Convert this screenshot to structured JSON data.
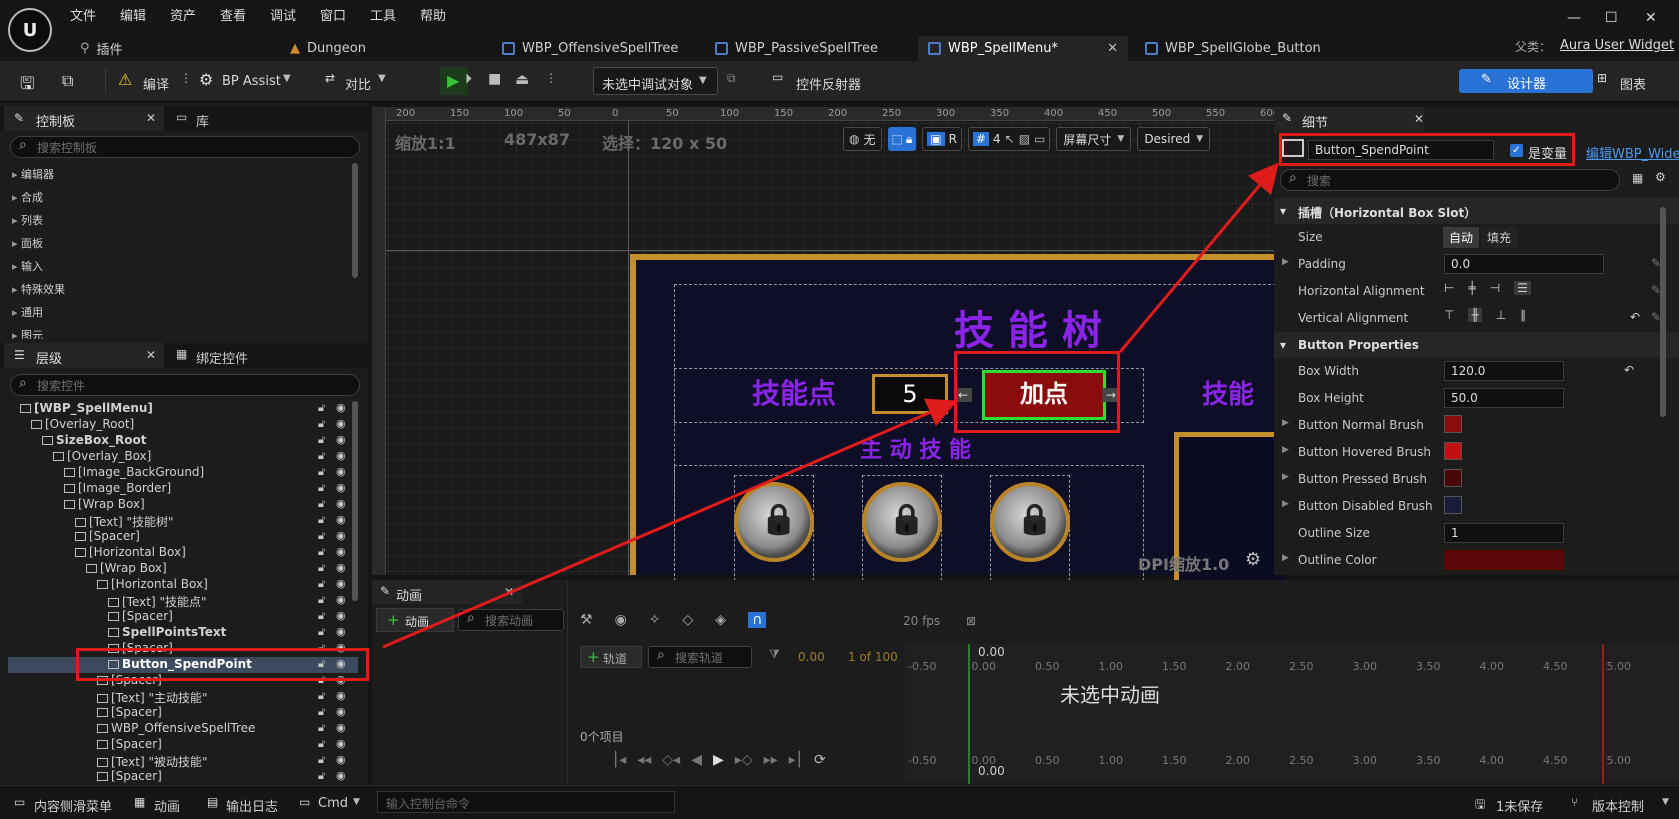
{
  "app": {
    "menu": [
      "文件",
      "编辑",
      "资产",
      "查看",
      "调试",
      "窗口",
      "工具",
      "帮助"
    ],
    "tabs": [
      "插件",
      "Dungeon",
      "WBP_OffensiveSpellTree",
      "WBP_PassiveSpellTree",
      "WBP_SpellMenu*",
      "WBP_SpellGlobe_Button"
    ],
    "parent_label": "父类：",
    "parent_value": "Aura User Widget"
  },
  "toolbar": {
    "compile": "编译",
    "bp_assist": "BP Assist",
    "diff": "对比",
    "debug_target": "未选中调试对象",
    "widget_reflector": "控件反射器",
    "designer": "设计器",
    "graph": "图表"
  },
  "palette": {
    "tab": "控制板",
    "lib_tab": "库",
    "search_placeholder": "搜索控制板",
    "items": [
      "编辑器",
      "合成",
      "列表",
      "面板",
      "输入",
      "特殊效果",
      "通用",
      "图元"
    ]
  },
  "hierarchy": {
    "tab": "层级",
    "bind_tab": "绑定控件",
    "search_placeholder": "搜索控件",
    "rows": [
      {
        "label": "[WBP_SpellMenu]",
        "indent": 0,
        "bold": true
      },
      {
        "label": "[Overlay_Root]",
        "indent": 1
      },
      {
        "label": "SizeBox_Root",
        "indent": 2,
        "bold": true
      },
      {
        "label": "[Overlay_Box]",
        "indent": 3
      },
      {
        "label": "[Image_BackGround]",
        "indent": 4
      },
      {
        "label": "[Image_Border]",
        "indent": 4
      },
      {
        "label": "[Wrap Box]",
        "indent": 4
      },
      {
        "label": "[Text] \"技能树\"",
        "indent": 5
      },
      {
        "label": "[Spacer]",
        "indent": 5
      },
      {
        "label": "[Horizontal Box]",
        "indent": 5
      },
      {
        "label": "[Wrap Box]",
        "indent": 6
      },
      {
        "label": "[Horizontal Box]",
        "indent": 7
      },
      {
        "label": "[Text] \"技能点\"",
        "indent": 8
      },
      {
        "label": "[Spacer]",
        "indent": 8
      },
      {
        "label": "SpellPointsText",
        "indent": 8,
        "bold": true
      },
      {
        "label": "[Spacer]",
        "indent": 8
      },
      {
        "label": "Button_SpendPoint",
        "indent": 8,
        "bold": true,
        "selected": true
      },
      {
        "label": "[Spacer]",
        "indent": 7
      },
      {
        "label": "[Text] \"主动技能\"",
        "indent": 7
      },
      {
        "label": "[Spacer]",
        "indent": 7
      },
      {
        "label": "WBP_OffensiveSpellTree",
        "indent": 7
      },
      {
        "label": "[Spacer]",
        "indent": 7
      },
      {
        "label": "[Text] \"被动技能\"",
        "indent": 7
      },
      {
        "label": "[Spacer]",
        "indent": 7
      }
    ]
  },
  "canvas": {
    "zoom": "缩放1:1",
    "size": "487x87",
    "selection": "选择：120 x 50",
    "none_label": "无",
    "r_label": "R",
    "grid_num": "4",
    "screen_size": "屏幕尺寸",
    "desired": "Desired",
    "dpi": "DPI缩放1.0",
    "ruler": [
      "200",
      "150",
      "100",
      "50",
      "0",
      "50",
      "100",
      "150",
      "200",
      "250",
      "300",
      "350",
      "400",
      "450",
      "500",
      "550",
      "600"
    ],
    "title": "技 能 树",
    "points_label": "技能点",
    "points_value": "5",
    "button_text": "加点",
    "offensive_label": "主 动 技 能",
    "right_partial": "技能"
  },
  "details": {
    "tab": "细节",
    "name": "Button_SpendPoint",
    "is_variable": "是变量",
    "edit_link": "编辑WBP_Wide",
    "search_placeholder": "搜索",
    "slot_section": "插槽（Horizontal Box Slot）",
    "size_label": "Size",
    "size_auto": "自动",
    "size_fill": "填充",
    "padding_label": "Padding",
    "padding_value": "0.0",
    "h_align": "Horizontal Alignment",
    "v_align": "Vertical Alignment",
    "button_section": "Button Properties",
    "box_width_label": "Box Width",
    "box_width_value": "120.0",
    "box_height_label": "Box Height",
    "box_height_value": "50.0",
    "normal_brush": "Button Normal Brush",
    "hovered_brush": "Button Hovered Brush",
    "pressed_brush": "Button Pressed Brush",
    "disabled_brush": "Button Disabled Brush",
    "outline_size_label": "Outline Size",
    "outline_size_value": "1",
    "outline_color_label": "Outline Color",
    "colors": {
      "normal": "#8a0c0c",
      "hovered": "#c01010",
      "pressed": "#4a0606",
      "disabled": "#1a1a3a",
      "outline": "#5a0808"
    }
  },
  "animation": {
    "tab": "动画",
    "add_anim": "动画",
    "search_anim": "搜索动画",
    "add_track": "轨道",
    "search_track": "搜索轨道",
    "fps": "20 fps",
    "time": "0.00",
    "frame": "1 of 100",
    "items": "0个项目",
    "no_anim": "未选中动画",
    "ruler": [
      "-0.50",
      "0.00",
      "0.50",
      "1.00",
      "1.50",
      "2.00",
      "2.50",
      "3.00",
      "3.50",
      "4.00",
      "4.50",
      "5.00"
    ]
  },
  "status": {
    "content_drawer": "内容侧滑菜单",
    "animation": "动画",
    "output_log": "输出日志",
    "cmd": "Cmd",
    "console_placeholder": "输入控制台命令",
    "unsaved": "1未保存",
    "version_control": "版本控制"
  }
}
